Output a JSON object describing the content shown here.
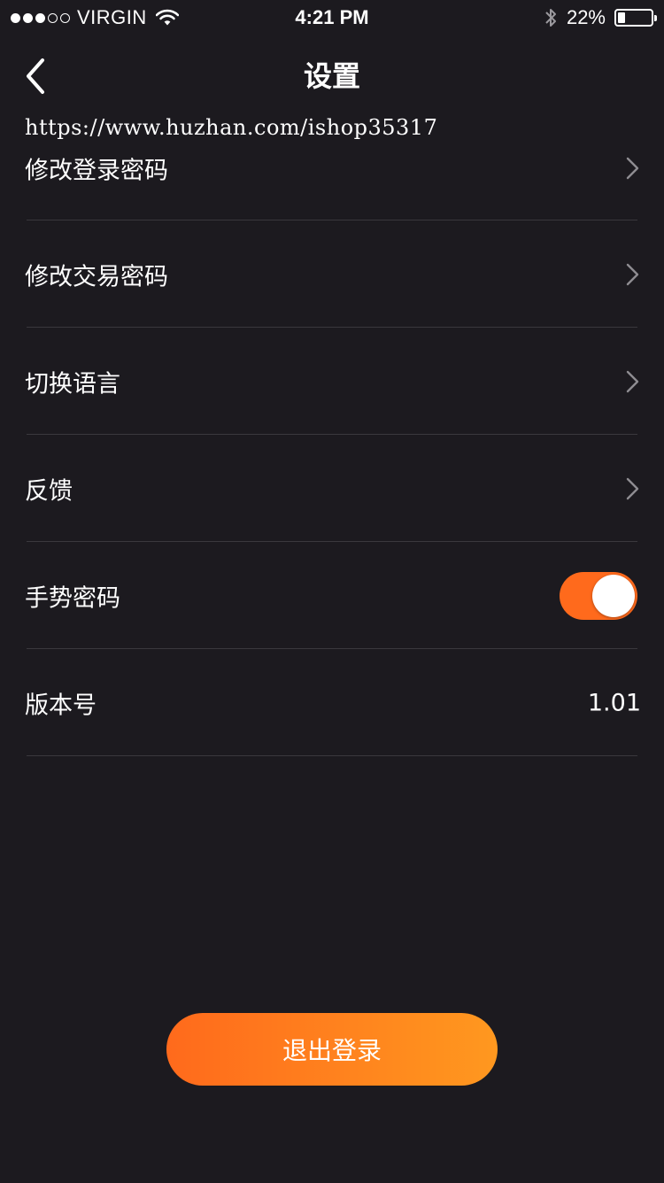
{
  "status_bar": {
    "signal_bars": [
      true,
      true,
      true,
      false,
      false
    ],
    "carrier": "VIRGIN",
    "time": "4:21 PM",
    "battery_percent": "22%",
    "battery_level": 0.22,
    "icons": [
      "wifi-icon",
      "bluetooth-icon",
      "battery-icon"
    ]
  },
  "nav": {
    "title": "设置",
    "back_icon": "chevron-left-icon"
  },
  "watermark": "https://www.huzhan.com/ishop35317",
  "settings": {
    "items": [
      {
        "label": "修改登录密码"
      },
      {
        "label": "修改交易密码"
      },
      {
        "label": "切换语言"
      },
      {
        "label": "反馈"
      }
    ],
    "gesture": {
      "label": "手势密码",
      "enabled": true
    },
    "version": {
      "label": "版本号",
      "value": "1.01"
    }
  },
  "logout": {
    "label": "退出登录"
  },
  "colors": {
    "background": "#1c1a1f",
    "accent": "#ff6a1c",
    "accent_end": "#ff981f",
    "divider": "#3a383d"
  }
}
